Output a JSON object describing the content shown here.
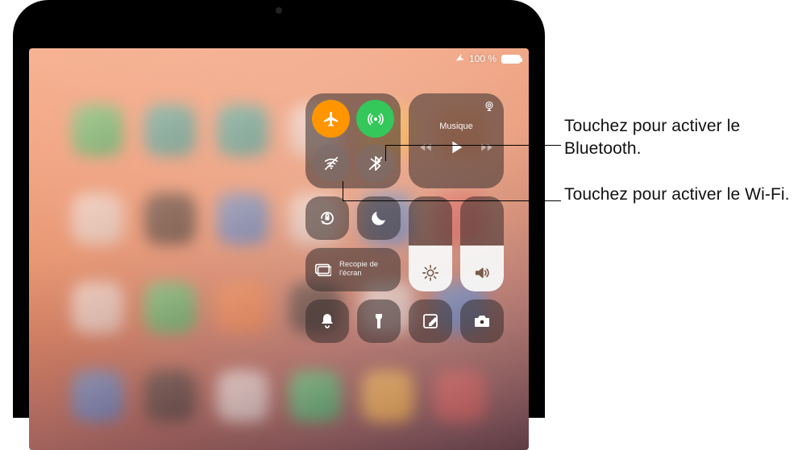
{
  "status": {
    "battery_text": "100 %",
    "battery_fill_pct": 100,
    "airplane_mode": true
  },
  "callouts": {
    "bluetooth": "Touchez pour activer le Bluetooth.",
    "wifi": "Touchez pour activer le Wi-Fi."
  },
  "connectivity": {
    "airplane": {
      "active": true
    },
    "airdrop": {
      "active": true
    },
    "wifi": {
      "active": false
    },
    "bluetooth": {
      "active": false
    }
  },
  "media": {
    "title": "Musique",
    "prev_enabled": false,
    "play_enabled": true,
    "next_enabled": false
  },
  "sliders": {
    "brightness_pct": 48,
    "volume_pct": 48
  },
  "tiles": {
    "rotation_lock_label": "Rotation Lock",
    "dnd_label": "Do Not Disturb",
    "screen_mirroring_label": "Recopie de l'écran",
    "silent_label": "Silent",
    "flashlight_label": "Flashlight",
    "notes_label": "Notes",
    "camera_label": "Camera"
  }
}
